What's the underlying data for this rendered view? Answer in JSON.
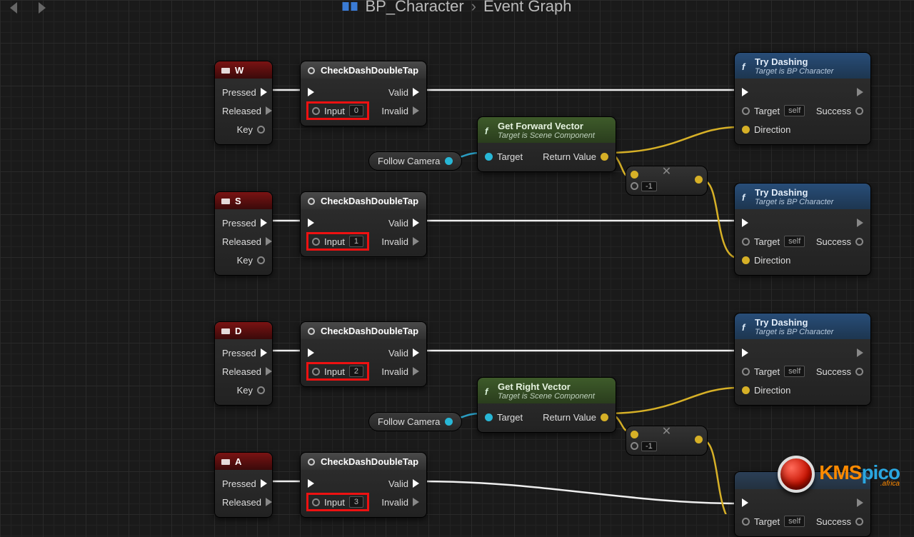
{
  "breadcrumb": {
    "asset": "BP_Character",
    "graph": "Event Graph"
  },
  "nav": {
    "back": "◄",
    "fwd": "►"
  },
  "labels": {
    "pressed": "Pressed",
    "released": "Released",
    "key": "Key",
    "valid": "Valid",
    "invalid": "Invalid",
    "input": "Input",
    "target": "Target",
    "return_value": "Return Value",
    "direction": "Direction",
    "success": "Success",
    "self": "self",
    "follow_camera": "Follow Camera"
  },
  "nodes": {
    "check_dash": {
      "title": "CheckDashDoubleTap"
    },
    "get_forward": {
      "title": "Get Forward Vector",
      "subtitle": "Target is Scene Component"
    },
    "get_right": {
      "title": "Get Right Vector",
      "subtitle": "Target is Scene Component"
    },
    "try_dash": {
      "title": "Try Dashing",
      "subtitle": "Target is BP Character"
    }
  },
  "keys": [
    {
      "name": "W",
      "input_idx": "0"
    },
    {
      "name": "S",
      "input_idx": "1"
    },
    {
      "name": "D",
      "input_idx": "2"
    },
    {
      "name": "A",
      "input_idx": "3"
    }
  ],
  "math": {
    "mul_constant": "-1"
  },
  "watermark": {
    "text_a": "KMS",
    "text_b": "pico",
    "suffix": ".africa"
  }
}
